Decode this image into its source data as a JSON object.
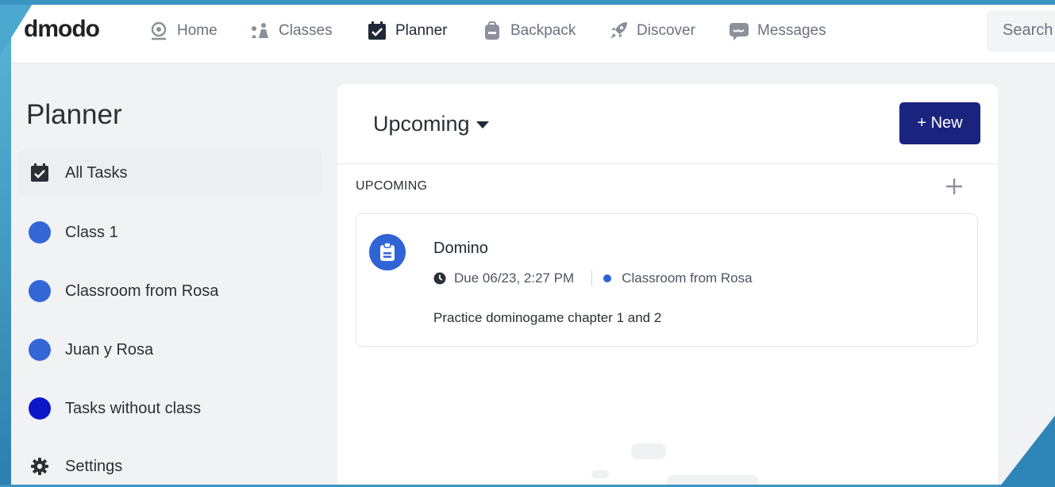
{
  "app": {
    "logo": "dmodo"
  },
  "nav": {
    "items": [
      {
        "label": "Home",
        "icon": "home-icon"
      },
      {
        "label": "Classes",
        "icon": "classes-icon"
      },
      {
        "label": "Planner",
        "icon": "planner-icon",
        "active": true
      },
      {
        "label": "Backpack",
        "icon": "backpack-icon"
      },
      {
        "label": "Discover",
        "icon": "rocket-icon"
      },
      {
        "label": "Messages",
        "icon": "messages-icon"
      }
    ],
    "search_placeholder": "Search"
  },
  "sidebar": {
    "title": "Planner",
    "items": [
      {
        "label": "All Tasks",
        "icon": "calendar-check-icon",
        "active": true
      },
      {
        "label": "Class 1",
        "color": "#3367d6"
      },
      {
        "label": "Classroom from Rosa",
        "color": "#3367d6"
      },
      {
        "label": "Juan y Rosa",
        "color": "#3367d6"
      },
      {
        "label": "Tasks without class",
        "color": "#0a17c9"
      },
      {
        "label": "Settings",
        "icon": "gear-icon"
      }
    ]
  },
  "main": {
    "filter_label": "Upcoming",
    "new_button": "+ New",
    "section_label": "UPCOMING",
    "tasks": [
      {
        "title": "Domino",
        "due": "Due 06/23, 2:27 PM",
        "class_name": "Classroom from Rosa",
        "description": "Practice dominogame chapter 1 and 2"
      }
    ]
  },
  "colors": {
    "accent": "#1a237e",
    "class_blue": "#3367d6",
    "frame": "#3b95c2"
  }
}
